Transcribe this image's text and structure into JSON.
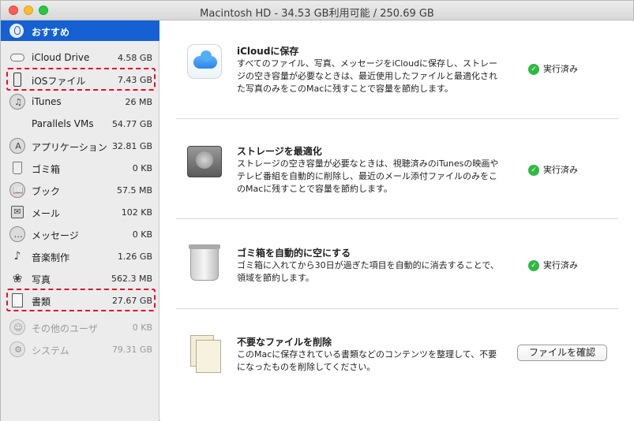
{
  "window": {
    "title": "Macintosh HD - 34.53 GB利用可能 / 250.69 GB"
  },
  "sidebar": {
    "selected": {
      "label": "おすすめ",
      "icon": "lightbulb-icon"
    },
    "items": [
      {
        "label": "iCloud Drive",
        "size": "4.58 GB",
        "icon": "cloud-icon"
      },
      {
        "label": "iOSファイル",
        "size": "7.43 GB",
        "icon": "iphone-icon"
      },
      {
        "label": "iTunes",
        "size": "26 MB",
        "icon": "music-note-icon"
      },
      {
        "label": "Parallels VMs",
        "size": "54.77 GB",
        "icon": ""
      },
      {
        "label": "アプリケーション",
        "size": "32.81 GB",
        "icon": "app-store-icon"
      },
      {
        "label": "ゴミ箱",
        "size": "0 KB",
        "icon": "trash-icon"
      },
      {
        "label": "ブック",
        "size": "57.5 MB",
        "icon": "book-icon"
      },
      {
        "label": "メール",
        "size": "102 KB",
        "icon": "mail-icon"
      },
      {
        "label": "メッセージ",
        "size": "0 KB",
        "icon": "message-bubble-icon"
      },
      {
        "label": "音楽制作",
        "size": "1.26 GB",
        "icon": "guitar-icon"
      },
      {
        "label": "写真",
        "size": "562.3 MB",
        "icon": "photos-flower-icon"
      },
      {
        "label": "書類",
        "size": "27.67 GB",
        "icon": "document-icon"
      },
      {
        "label": "その他のユーザ",
        "size": "0 KB",
        "icon": "users-icon"
      },
      {
        "label": "システム",
        "size": "79.31 GB",
        "icon": "gear-icon"
      }
    ]
  },
  "recommendations": [
    {
      "title": "iCloudに保存",
      "description": "すべてのファイル、写真、メッセージをiCloudに保存し、ストレージの空き容量が必要なときは、最近使用したファイルと最適化された写真のみをこのMacに残すことで容量を節約します。",
      "status": "実行済み",
      "icon": "icloud-icon"
    },
    {
      "title": "ストレージを最適化",
      "description": "ストレージの空き容量が必要なときは、視聴済みのiTunesの映画やテレビ番組を自動的に削除し、最近のメール添付ファイルのみをこのMacに残すことで容量を節約します。",
      "status": "実行済み",
      "icon": "hard-drive-icon"
    },
    {
      "title": "ゴミ箱を自動的に空にする",
      "description": "ゴミ箱に入れてから30日が過ぎた項目を自動的に消去することで、領域を節約します。",
      "status": "実行済み",
      "icon": "trash-full-icon"
    },
    {
      "title": "不要なファイルを削除",
      "description": "このMacに保存されている書類などのコンテンツを整理して、不要になったものを削除してください。",
      "button": "ファイルを確認",
      "icon": "documents-icon"
    }
  ],
  "colors": {
    "selection": "#1560d3",
    "check_green": "#2fb944",
    "highlight_dash": "#e4102a"
  }
}
